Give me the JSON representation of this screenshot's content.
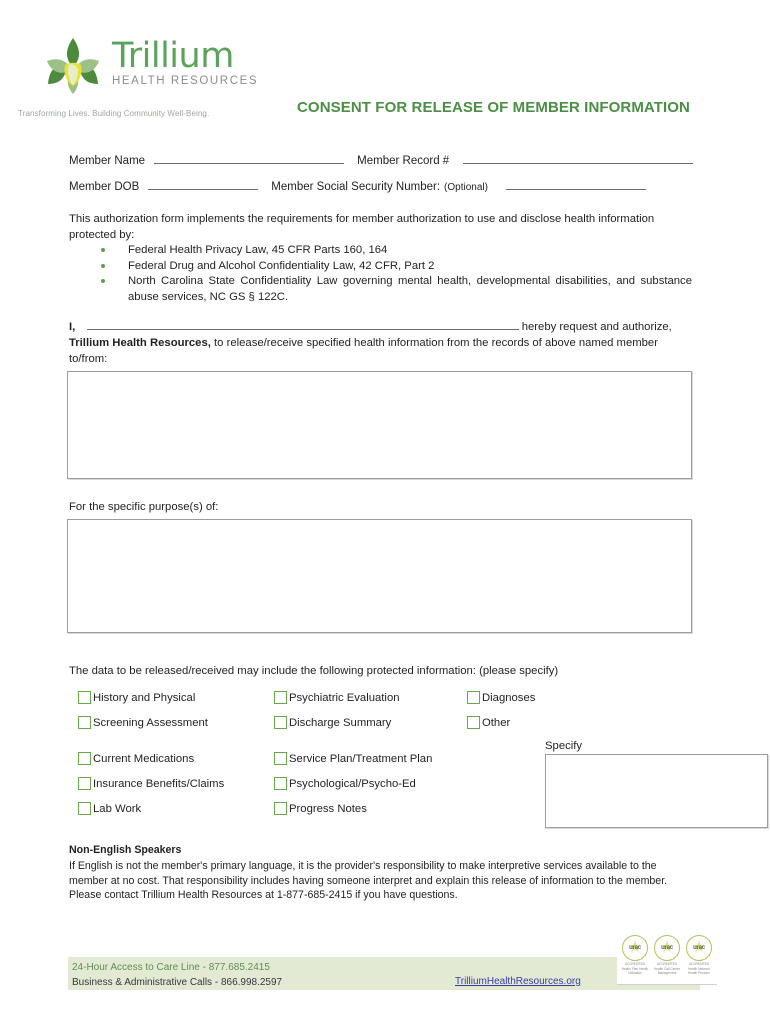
{
  "document": {
    "title": "CONSENT FOR RELEASE OF MEMBER INFORMATION"
  },
  "logo": {
    "name": "Trillium",
    "subtitle": "HEALTH RESOURCES",
    "tagline": "Transforming Lives. Building Community Well-Being.",
    "mark_colors": {
      "petal_dark": "#4b8b3b",
      "petal_light": "#9cc186",
      "center_yellow": "#e8e138",
      "center_cream": "#e8ecc9"
    },
    "name_color": "#5ba35b",
    "subtitle_color": "#8c8c8c"
  },
  "member_fields": {
    "row1": {
      "label_name": "Member Name",
      "label_record": "Member Record #"
    },
    "row2": {
      "label_dob": "Member DOB",
      "label_ssn": "Member Social Security Number:",
      "label_ssn_optional": "(Optional)"
    }
  },
  "intro": {
    "paragraph": "This authorization form implements the requirements for member authorization to use and disclose health information protected by:",
    "bullets": [
      "Federal Health Privacy Law, 45 CFR Parts 160, 164",
      "Federal Drug and Alcohol Confidentiality Law, 42 CFR, Part 2",
      "North Carolina State Confidentiality Law governing mental health, developmental disabilities, and substance abuse services, NC GS § 122C."
    ]
  },
  "authorization": {
    "i_label": "I,",
    "hereby": "hereby request and authorize,",
    "org_bold": "Trillium Health Resources,",
    "continuation": "to release/receive specified health information from the records of above named member to/from:"
  },
  "purpose": {
    "label": "For the specific purpose(s) of:"
  },
  "checklist": {
    "intro": "The data to be released/received may include the following protected information: (please specify)",
    "column1": [
      "History and Physical",
      "Screening Assessment",
      "Current Medications",
      "Insurance Benefits/Claims",
      "Lab Work"
    ],
    "column2": [
      "Psychiatric Evaluation",
      "Discharge Summary",
      "Service Plan/Treatment Plan",
      "Psychological/Psycho-Ed",
      "Progress Notes"
    ],
    "column3": [
      "Diagnoses",
      "Other"
    ],
    "specify_label": "Specify",
    "checkbox_border_color": "#6aa84f"
  },
  "non_english": {
    "heading": "Non-English Speakers",
    "body": "If English is not the member's primary language, it is the provider's responsibility to make interpretive services available to the member at no cost.  That responsibility includes having someone interpret and explain this release of information to the member.  Please contact Trillium Health Resources at 1-877-685-2415 if you have questions."
  },
  "footer": {
    "line1": "24-Hour Access to Care Line - 877.685.2415",
    "line2": "Business & Administrative Calls - 866.998.2597",
    "link": "TrilliumHealthResources.org",
    "band_color": "#e3ead3",
    "line1_color": "#5f8f4e",
    "link_color": "#3b3ba8"
  },
  "seals": [
    {
      "word": "urac",
      "caption": "ACCREDITED",
      "sub": "Health Plan\nHealth Utilization"
    },
    {
      "word": "urac",
      "caption": "ACCREDITED",
      "sub": "Health\nCall Center\nManagement"
    },
    {
      "word": "urac",
      "caption": "ACCREDITED",
      "sub": "Health Network\nHealth Provider"
    }
  ]
}
